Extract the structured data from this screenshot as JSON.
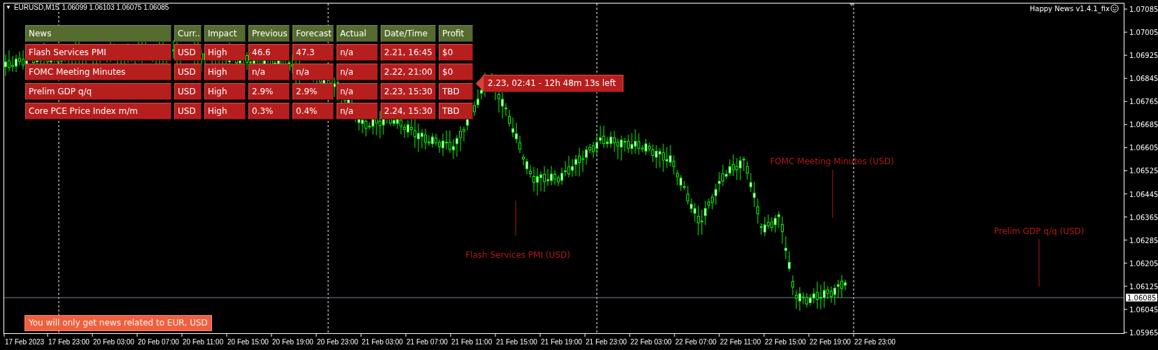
{
  "chart": {
    "menu_icon": "▼",
    "symbol": "EURUSD,M15",
    "quote": "1.06099 1.06103 1.06075 1.06085",
    "indicator": "Happy News v1.4.1_fix"
  },
  "news_table": {
    "columns": [
      "News",
      "Curr..",
      "Impact",
      "Previous",
      "Forecast",
      "Actual",
      "Date/Time",
      "Profit"
    ],
    "rows": [
      [
        "Flash Services PMI",
        "USD",
        "High",
        "46.6",
        "47.3",
        "n/a",
        "2.21, 16:45",
        "$0"
      ],
      [
        "FOMC Meeting Minutes",
        "USD",
        "High",
        "n/a",
        "n/a",
        "n/a",
        "2.22, 21:00",
        "$0"
      ],
      [
        "Prelim GDP q/q",
        "USD",
        "High",
        "2.9%",
        "2.9%",
        "n/a",
        "2.23, 15:30",
        "TBD"
      ],
      [
        "Core PCE Price Index m/m",
        "USD",
        "High",
        "0.3%",
        "0.4%",
        "n/a",
        "2.24, 15:30",
        "TBD"
      ]
    ]
  },
  "countdown": "2.23, 02:41 - 12h 48m 13s left",
  "event_labels": [
    {
      "text": "Flash Services PMI (USD)"
    },
    {
      "text": "FOMC Meeting Minutes (USD)"
    },
    {
      "text": "Prelim GDP q/q (USD)"
    }
  ],
  "notice": "You will only get news related to EUR, USD",
  "price_axis": {
    "labels": [
      "1.07085",
      "1.07005",
      "1.06925",
      "1.06845",
      "1.06765",
      "1.06685",
      "1.06605",
      "1.06525",
      "1.06445",
      "1.06365",
      "1.06285",
      "1.06205",
      "1.06125",
      "1.06045",
      "1.05965"
    ],
    "current": "1.06085"
  },
  "time_axis": {
    "labels": [
      "17 Feb 2023",
      "17 Feb 23:00",
      "20 Feb 03:00",
      "20 Feb 07:00",
      "20 Feb 11:00",
      "20 Feb 15:00",
      "20 Feb 19:00",
      "20 Feb 23:00",
      "21 Feb 03:00",
      "21 Feb 07:00",
      "21 Feb 11:00",
      "21 Feb 15:00",
      "21 Feb 19:00",
      "21 Feb 23:00",
      "22 Feb 03:00",
      "22 Feb 07:00",
      "22 Feb 11:00",
      "22 Feb 15:00",
      "22 Feb 19:00",
      "22 Feb 23:00"
    ]
  }
}
